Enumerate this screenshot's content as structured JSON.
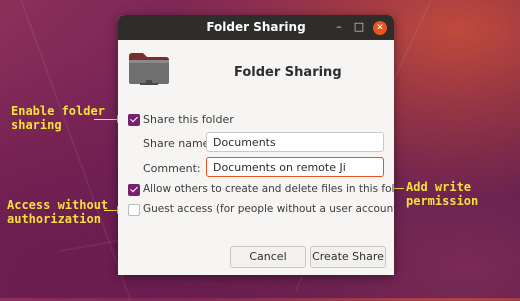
{
  "window": {
    "title": "Folder Sharing",
    "controls": {
      "minimize": "–",
      "maximize": "□",
      "close": "✕"
    }
  },
  "header": {
    "icon": "folder-share-icon",
    "title": "Folder Sharing"
  },
  "form": {
    "share_checkbox": {
      "label": "Share this folder",
      "checked": true
    },
    "share_name": {
      "label": "Share name:",
      "value": "Documents"
    },
    "comment": {
      "label": "Comment:",
      "value": "Documents on remote Ji"
    },
    "allow_write": {
      "label": "Allow others to create and delete files in this folder",
      "checked": true
    },
    "guest_access": {
      "label": "Guest access (for people without a user account)",
      "checked": false
    }
  },
  "buttons": {
    "cancel": "Cancel",
    "create": "Create Share"
  },
  "annotations": {
    "enable_sharing": [
      "Enable folder",
      "sharing"
    ],
    "access_without_auth": [
      "Access without",
      "authorization"
    ],
    "add_write": [
      "Add write",
      "permission"
    ]
  },
  "colors": {
    "accent": "#77216f",
    "focus": "#e95420",
    "annotation": "#f4e23a"
  }
}
